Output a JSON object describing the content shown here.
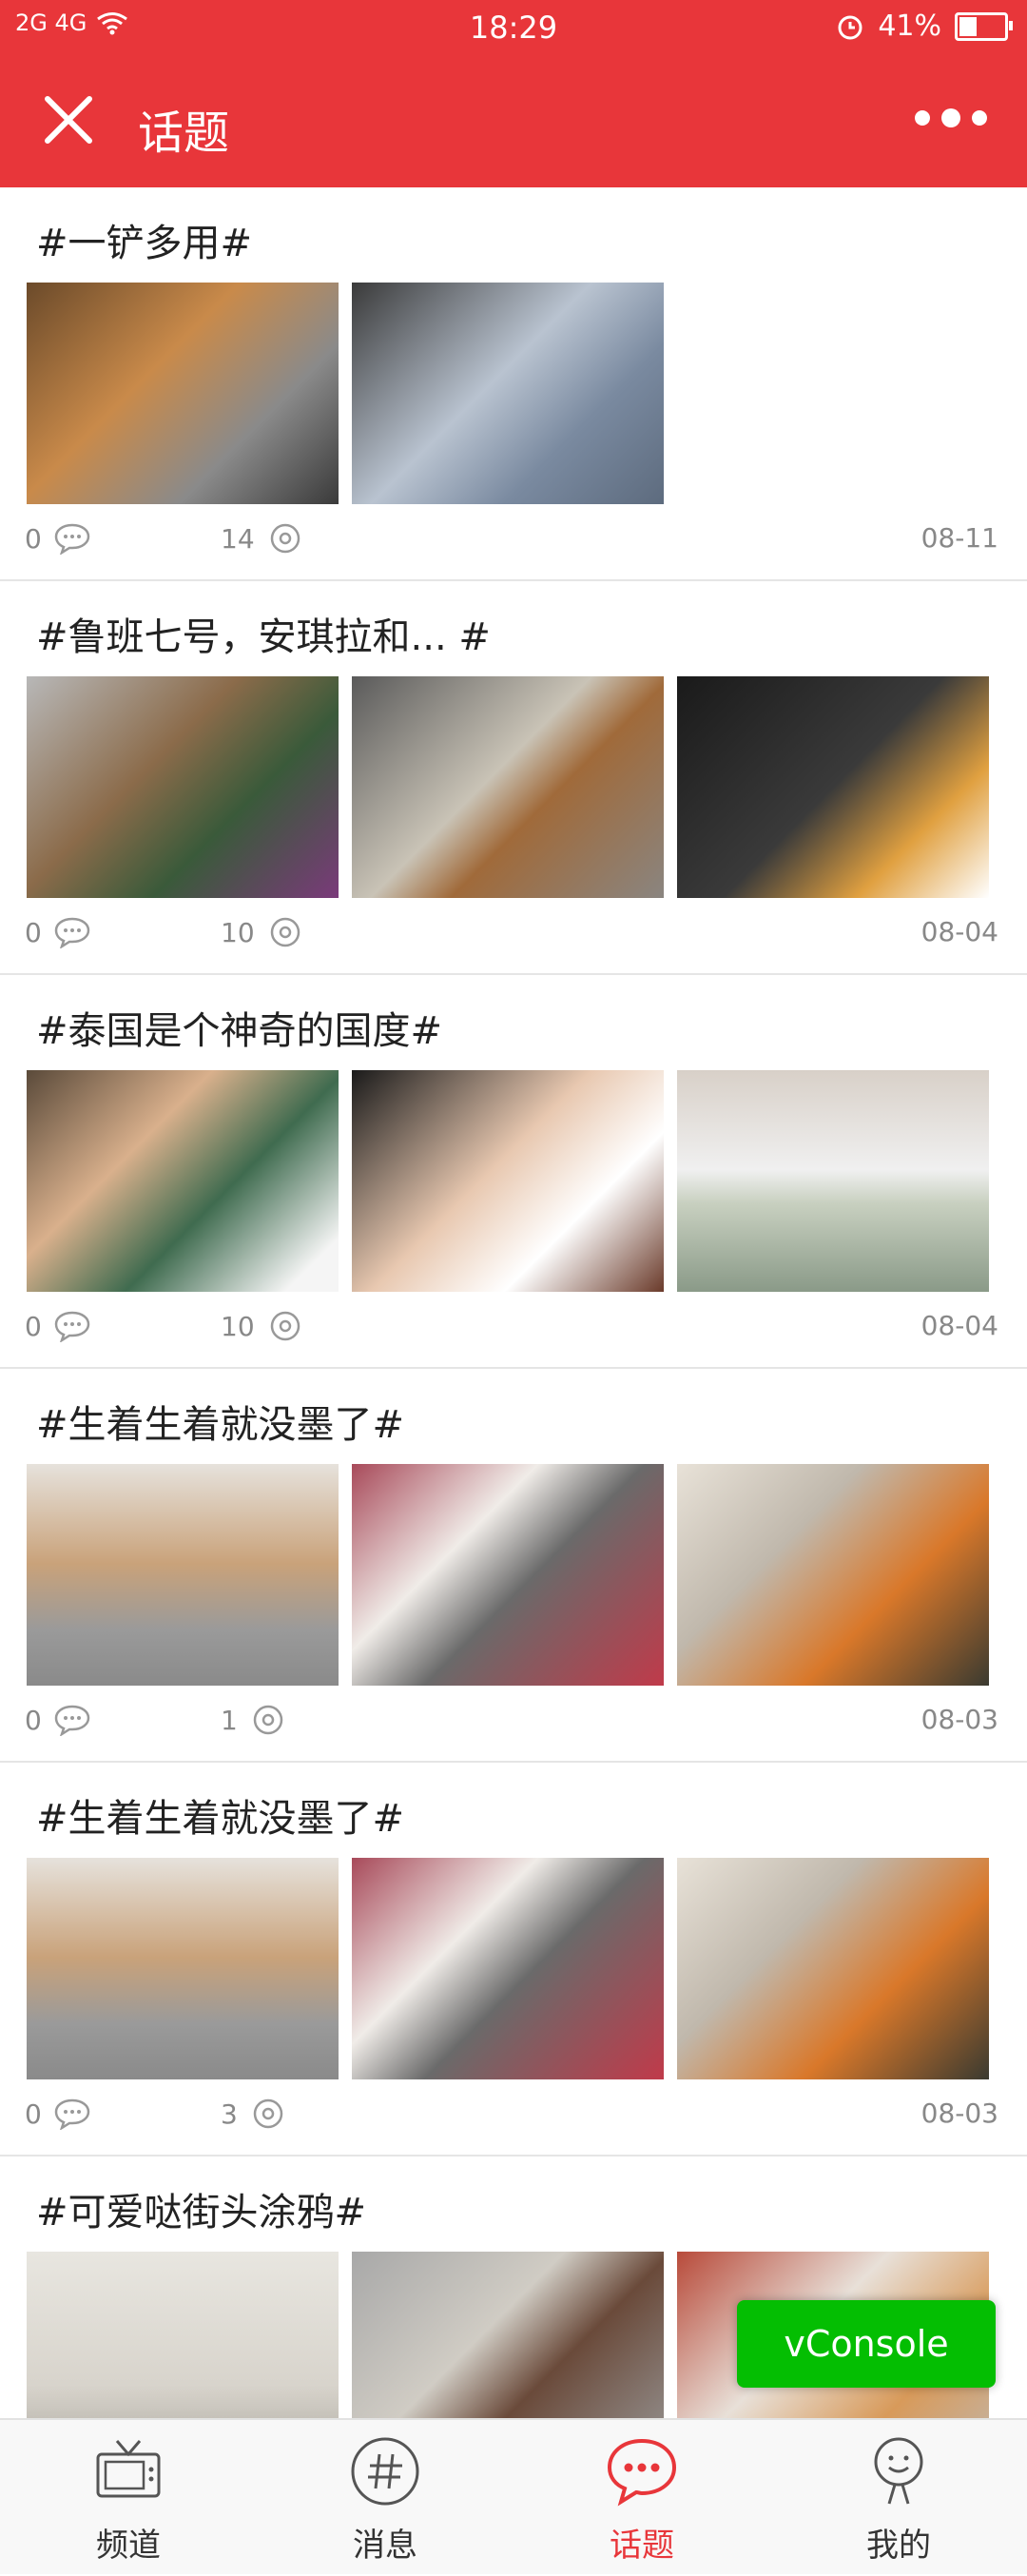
{
  "status_bar": {
    "network": "2G 4G",
    "time": "18:29",
    "battery": "41%"
  },
  "navbar": {
    "title": "话题"
  },
  "topics": [
    {
      "title": "#一铲多用#",
      "comments": "0",
      "views": "14",
      "date": "08-11"
    },
    {
      "title": "#鲁班七号，安琪拉和... #",
      "comments": "0",
      "views": "10",
      "date": "08-04"
    },
    {
      "title": "#泰国是个神奇的国度#",
      "comments": "0",
      "views": "10",
      "date": "08-04"
    },
    {
      "title": "#生着生着就没墨了#",
      "comments": "0",
      "views": "1",
      "date": "08-03"
    },
    {
      "title": "#生着生着就没墨了#",
      "comments": "0",
      "views": "3",
      "date": "08-03"
    },
    {
      "title": "#可爱哒街头涂鸦#"
    }
  ],
  "vconsole": {
    "label": "vConsole"
  },
  "tabbar": {
    "items": [
      {
        "label": "频道",
        "icon": "tv-icon"
      },
      {
        "label": "消息",
        "icon": "hashtag-icon"
      },
      {
        "label": "话题",
        "icon": "chat-bubble-icon"
      },
      {
        "label": "我的",
        "icon": "user-icon"
      }
    ],
    "active_color": "#e8363a"
  },
  "colors": {
    "primary": "#e8363a",
    "vconsole": "#04be02"
  }
}
